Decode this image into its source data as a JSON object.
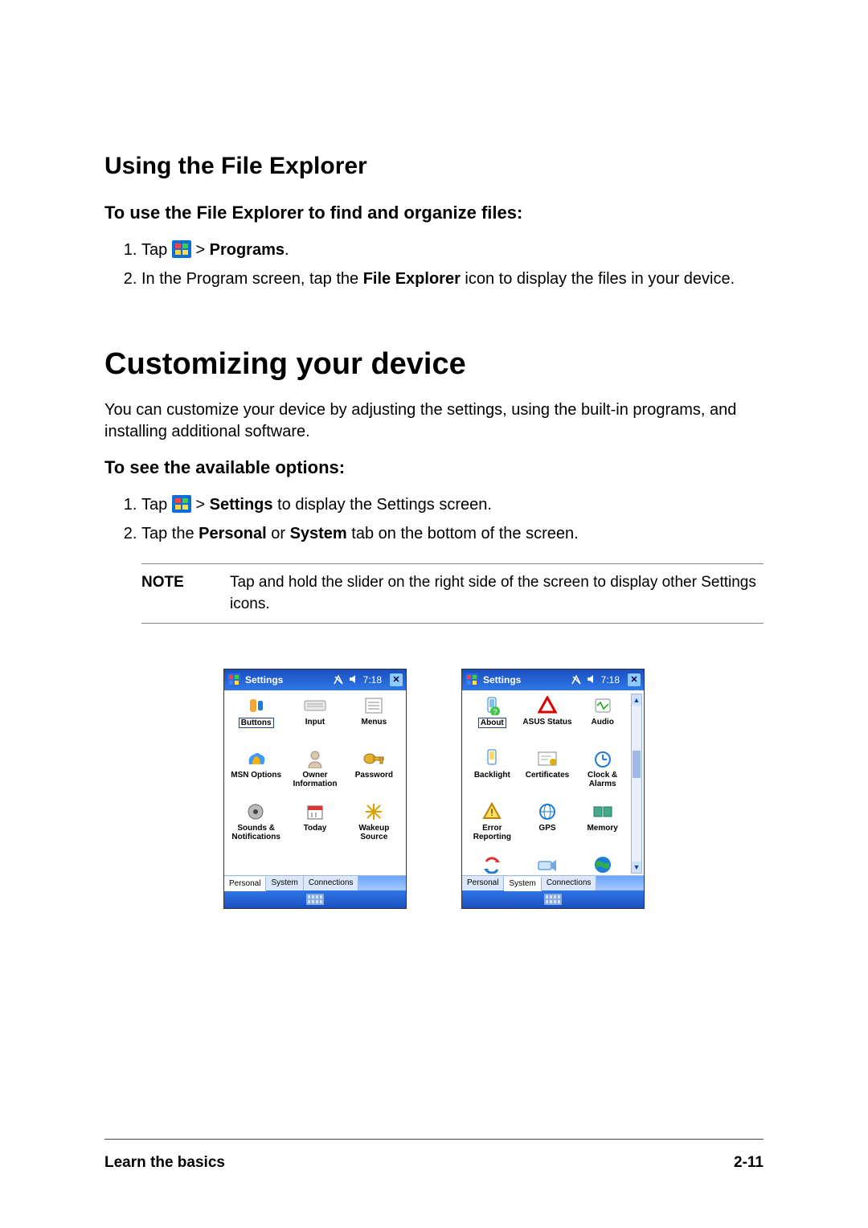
{
  "section1": {
    "title": "Using the File Explorer",
    "subtitle": "To use the File Explorer to find and organize files:",
    "step1_a": "Tap ",
    "step1_b": " > ",
    "step1_bold": "Programs",
    "step1_c": ".",
    "step2_a": "In the Program screen, tap the ",
    "step2_bold": "File Explorer",
    "step2_b": " icon to display the files in your device."
  },
  "section2": {
    "title": "Customizing your device",
    "intro": "You can customize your device by adjusting the settings, using the built-in programs, and installing additional software.",
    "subtitle": "To see the available options:",
    "step1_a": "Tap ",
    "step1_b": " > ",
    "step1_bold": "Settings",
    "step1_c": " to display the Settings screen.",
    "step2_a": "Tap the ",
    "step2_bold1": "Personal",
    "step2_mid": " or ",
    "step2_bold2": "System",
    "step2_b": " tab on the bottom of the screen."
  },
  "note": {
    "label": "NOTE",
    "text": "Tap and hold the slider on the right side of the screen to display other Settings icons."
  },
  "screens": {
    "common": {
      "title": "Settings",
      "time": "7:18",
      "tabs": [
        "Personal",
        "System",
        "Connections"
      ]
    },
    "left": {
      "active_tab": 0,
      "icons": [
        {
          "label": "Buttons",
          "boxed": true
        },
        {
          "label": "Input"
        },
        {
          "label": "Menus"
        },
        {
          "label": "MSN Options"
        },
        {
          "label": "Owner Information"
        },
        {
          "label": "Password"
        },
        {
          "label": "Sounds & Notifications"
        },
        {
          "label": "Today"
        },
        {
          "label": "Wakeup Source"
        }
      ]
    },
    "right": {
      "active_tab": 1,
      "has_scrollbar": true,
      "icons": [
        {
          "label": "About",
          "boxed": true
        },
        {
          "label": "ASUS Status"
        },
        {
          "label": "Audio"
        },
        {
          "label": "Backlight"
        },
        {
          "label": "Certificates"
        },
        {
          "label": "Clock & Alarms"
        },
        {
          "label": "Error Reporting"
        },
        {
          "label": "GPS"
        },
        {
          "label": "Memory"
        }
      ],
      "extra_row": [
        {
          "label": ""
        },
        {
          "label": ""
        },
        {
          "label": ""
        }
      ]
    }
  },
  "footer": {
    "left": "Learn the basics",
    "right": "2-11"
  }
}
